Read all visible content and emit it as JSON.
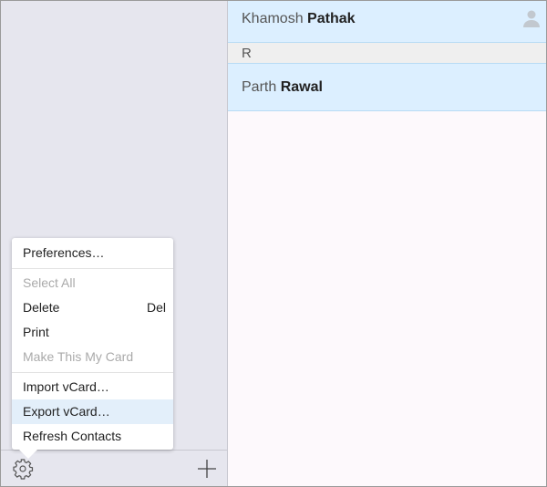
{
  "contacts": [
    {
      "first": "Khamosh",
      "last": "Pathak"
    },
    {
      "section": "R"
    },
    {
      "first": "Parth",
      "last": "Rawal"
    }
  ],
  "menu": {
    "preferences": "Preferences…",
    "select_all": "Select All",
    "delete": "Delete",
    "delete_shortcut": "Del",
    "print": "Print",
    "make_my_card": "Make This My Card",
    "import": "Import vCard…",
    "export": "Export vCard…",
    "refresh": "Refresh Contacts"
  },
  "icons": {
    "settings": "gear-icon",
    "add": "plus-icon",
    "avatar": "person-icon"
  }
}
